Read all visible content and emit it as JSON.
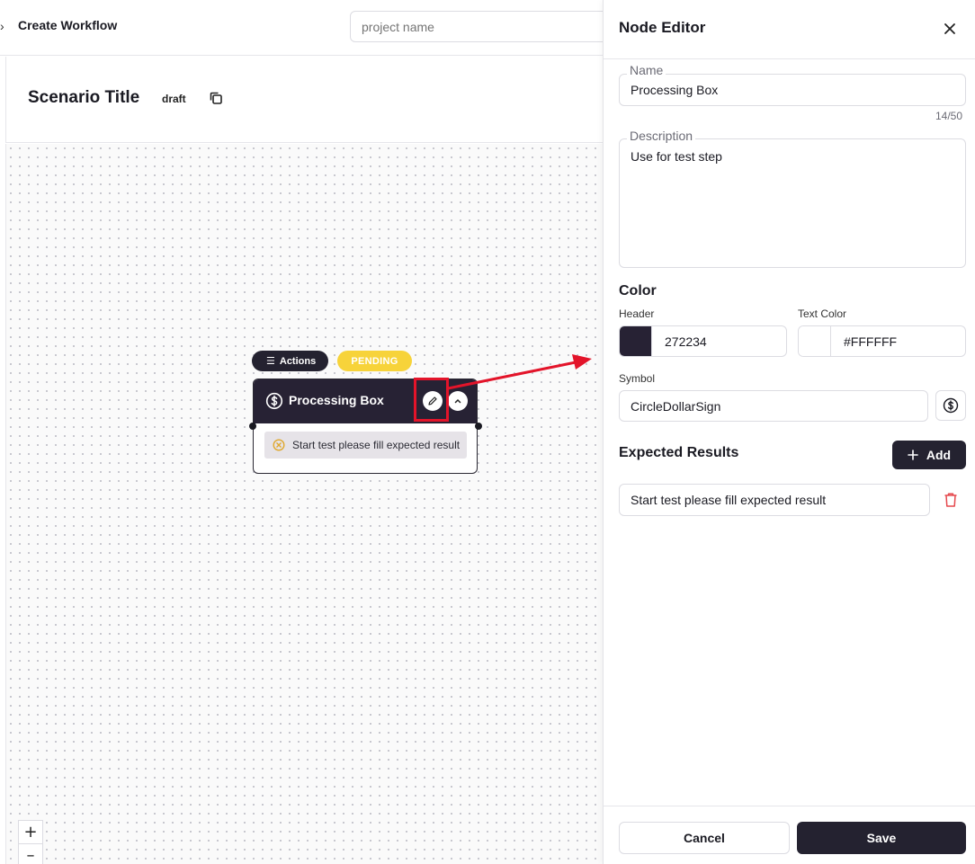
{
  "topbar": {
    "breadcrumb": "Create Workflow",
    "project_placeholder": "project name"
  },
  "scenario": {
    "title": "Scenario Title",
    "status": "draft"
  },
  "node": {
    "actions_label": "Actions",
    "status_label": "PENDING",
    "name": "Processing Box",
    "expected_result": "Start test please fill expected result",
    "header_color": "#272234",
    "status_color": "#f7d33a"
  },
  "zoom": {
    "in": "+",
    "out": "–"
  },
  "editor": {
    "title": "Node Editor",
    "name_label": "Name",
    "name_value": "Processing Box",
    "name_counter": "14/50",
    "description_label": "Description",
    "description_value": "Use for test step",
    "color_section": "Color",
    "header_label": "Header",
    "header_value": "272234",
    "text_color_label": "Text Color",
    "text_color_value": "#FFFFFF",
    "symbol_label": "Symbol",
    "symbol_value": "CircleDollarSign",
    "expected_section": "Expected Results",
    "add_label": "Add",
    "expected_items": [
      "Start test please fill expected result"
    ],
    "cancel_label": "Cancel",
    "save_label": "Save"
  },
  "icons": {
    "chevron": "chevron-right-icon",
    "copy": "copy-icon",
    "symbol": "circle-dollar-sign-icon",
    "edit": "pencil-icon",
    "collapse": "chevron-up-icon",
    "pending_item": "circle-x-icon",
    "close": "close-icon",
    "plus": "plus-icon",
    "trash": "trash-icon"
  },
  "colors": {
    "accent_dark": "#242230",
    "annotation_red": "#e3142a",
    "trash_red": "#e5484d"
  }
}
